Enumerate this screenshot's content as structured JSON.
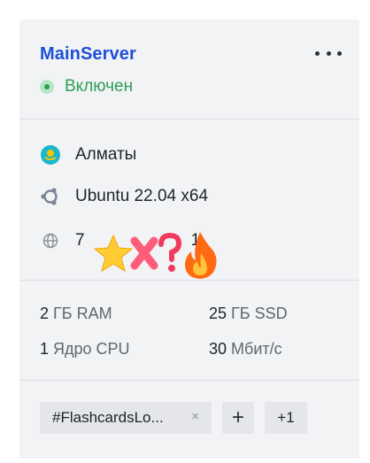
{
  "server": {
    "name": "MainServer",
    "status": "Включен",
    "status_color": "#2e9e55"
  },
  "menu": {
    "icon": "more-horizontal-icon"
  },
  "info": {
    "location": {
      "icon": "kazakhstan-flag-icon",
      "text": "Алматы"
    },
    "os": {
      "icon": "ubuntu-icon",
      "text": "Ubuntu 22.04 x64"
    },
    "ip": {
      "icon": "globe-icon",
      "text_start": "7",
      "text_end": "1"
    }
  },
  "overlay_emojis": [
    "⭐",
    "❌",
    "❓",
    "🔥"
  ],
  "specs": {
    "ram": {
      "value": "2",
      "unit": "ГБ RAM"
    },
    "disk": {
      "value": "25",
      "unit": "ГБ SSD"
    },
    "cpu": {
      "value": "1",
      "unit": "Ядро CPU"
    },
    "net": {
      "value": "30",
      "unit": "Мбит/с"
    }
  },
  "tags": {
    "items": [
      "#FlashcardsLo..."
    ],
    "close_label": "×",
    "add_label": "+",
    "more_label": "+1"
  },
  "colors": {
    "title": "#1d4fd8",
    "card_bg": "#f2f3f5",
    "flag_blue": "#18b7cf",
    "flag_sun": "#f4c400"
  }
}
